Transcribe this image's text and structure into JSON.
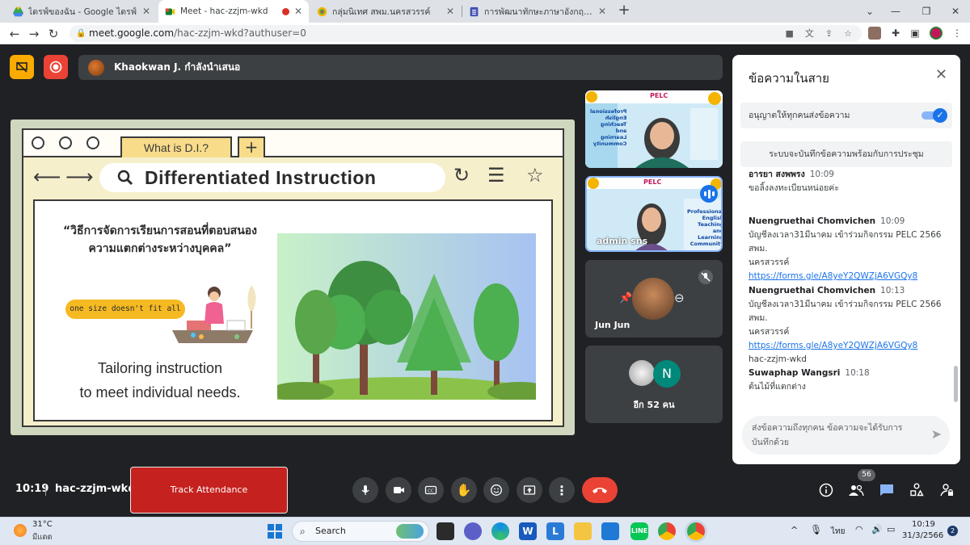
{
  "browser": {
    "tabs": [
      {
        "title": "ไดรฟ์ของฉัน - Google ไดรฟ์",
        "favicon": "google-drive-icon",
        "active": false
      },
      {
        "title": "Meet - hac-zzjm-wkd",
        "favicon": "google-meet-icon",
        "active": true,
        "recording_indicator": true
      },
      {
        "title": "กลุ่มนิเทศ สพม.นครสวรรค์",
        "favicon": "globe-icon",
        "active": false
      },
      {
        "title": "การพัฒนาทักษะภาษาอังกฤษ English",
        "favicon": "google-forms-icon",
        "active": false
      }
    ],
    "url_host": "meet.google.com",
    "url_path": "/hac-zzjm-wkd?authuser=0"
  },
  "meet": {
    "presenter_text": "Khaokwan J. กำลังนำเสนอ",
    "clock": "10:19",
    "meeting_code": "hac-zzjm-wkd",
    "track_attendance_label": "Track Attendance",
    "participant_count": "56",
    "accent_color": "#8ab4f8",
    "end_call_color": "#ea4335"
  },
  "slide": {
    "tab_label": "What is D.I.?",
    "title": "Differentiated Instruction",
    "thai_quote_line1": "“วิธีการจัดการเรียนการสอนที่ตอบสนอง",
    "thai_quote_line2": "ความแตกต่างระหว่างบุคคล”",
    "pill_text": "one size doesn't fit all",
    "tagline_line1": "Tailoring instruction",
    "tagline_line2": "to meet individual needs."
  },
  "tiles": [
    {
      "name": "",
      "banner": "PELC",
      "caption_lines": [
        "Professional",
        "English",
        "Teaching",
        "and",
        "Learning",
        "Community"
      ]
    },
    {
      "name": "admin sns",
      "banner": "PELC",
      "caption_lines": [
        "Professional",
        "English",
        "Teaching",
        "and",
        "Learning",
        "Community"
      ]
    },
    {
      "name": "Jun Jun",
      "muted": true
    },
    {
      "name": "อีก 52 คน",
      "avatar_letter": "N"
    }
  ],
  "chat": {
    "title": "ข้อความในสาย",
    "allow_label": "อนุญาตให้ทุกคนส่งข้อความ",
    "allow_enabled": true,
    "record_note": "ระบบจะบันทึกข้อความพร้อมกับการประชุม",
    "messages": [
      {
        "sender": "อารยา สงพพรง",
        "time": "10:09",
        "lines": [
          "ขอลิ้งลงทะเบียนหน่อยค่ะ"
        ],
        "link": ""
      },
      {
        "sender": "Nuengruethai Chomvichen",
        "time": "10:09",
        "lines": [
          "บัญชีลงเวลา31มีนาคม เข้าร่วมกิจกรรม PELC 2566 สพม.",
          "นครสวรรค์"
        ],
        "link": "https://forms.gle/A8yeY2QWZjA6VGQy8"
      },
      {
        "sender": "Nuengruethai Chomvichen",
        "time": "10:13",
        "lines": [
          "บัญชีลงเวลา31มีนาคม เข้าร่วมกิจกรรม PELC 2566 สพม.",
          "นครสวรรค์"
        ],
        "link": "https://forms.gle/A8yeY2QWZjA6VGQy8",
        "extra": "hac-zzjm-wkd"
      },
      {
        "sender": "Suwaphap Wangsri",
        "time": "10:18",
        "lines": [
          "ต้นไม้ที่แตกต่าง"
        ],
        "link": ""
      }
    ],
    "input_placeholder": "ส่งข้อความถึงทุกคน ข้อความจะได้รับการบันทึกด้วย"
  },
  "taskbar": {
    "temperature": "31°C",
    "weather": "มีแดด",
    "search_label": "Search",
    "language": "ไทย",
    "time": "10:19",
    "date": "31/3/2566",
    "notifications": "2"
  }
}
